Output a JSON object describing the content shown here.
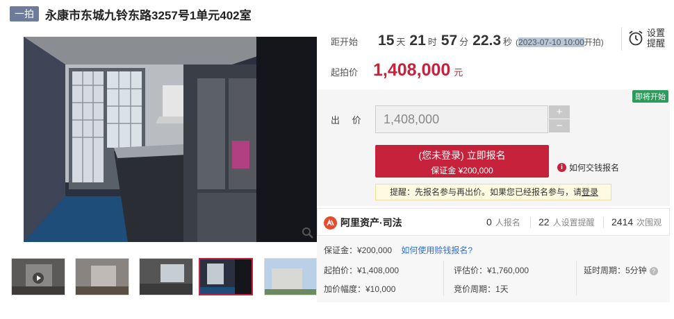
{
  "header": {
    "badge": "一拍",
    "title": "永康市东城九铃东路3257号1单元402室"
  },
  "countdown": {
    "label": "距开始",
    "days": "15",
    "days_unit": "天",
    "hours": "21",
    "hours_unit": "时",
    "minutes": "57",
    "minutes_unit": "分",
    "seconds": "22.3",
    "seconds_unit": "秒",
    "start_open": "(",
    "start_time": "2023-07-10 10:00",
    "start_suffix": "开拍)"
  },
  "start_price": {
    "label": "起拍价",
    "value": "1,408,000",
    "unit": "元"
  },
  "remind": {
    "line1": "设置",
    "line2": "提醒",
    "icon": "alarm-clock-icon"
  },
  "bid": {
    "status_tag": "即将开始",
    "label": "出 价",
    "value": "1,408,000",
    "plus": "+",
    "minus": "−",
    "signup_line1": "(您未登录) 立即报名",
    "signup_line2": "保证金 ¥200,000",
    "howto": "如何交钱报名",
    "tip_text": "提醒：先报名参与再出价。如果您已经报名参与，请",
    "tip_link": "登录"
  },
  "platform": {
    "name": "阿里资产·司法",
    "stats": [
      {
        "num": "0",
        "text": "人报名"
      },
      {
        "num": "22",
        "text": "人设置提醒"
      },
      {
        "num": "2414",
        "text": "次围观"
      }
    ]
  },
  "details": {
    "deposit": "保证金：¥200,000",
    "deposit_link": "如何使用赊钱报名?",
    "start_price": "起拍价：¥1,408,000",
    "appraisal": "评估价：¥1,760,000",
    "delay": "延时周期：5分钟",
    "increment": "加价幅度：¥10,000",
    "cycle": "竞价周期：1天"
  },
  "colors": {
    "accent": "#c6223b",
    "badge": "#6f7b9b",
    "status_green": "#2d9b5b",
    "link_blue": "#2d6fd2"
  }
}
